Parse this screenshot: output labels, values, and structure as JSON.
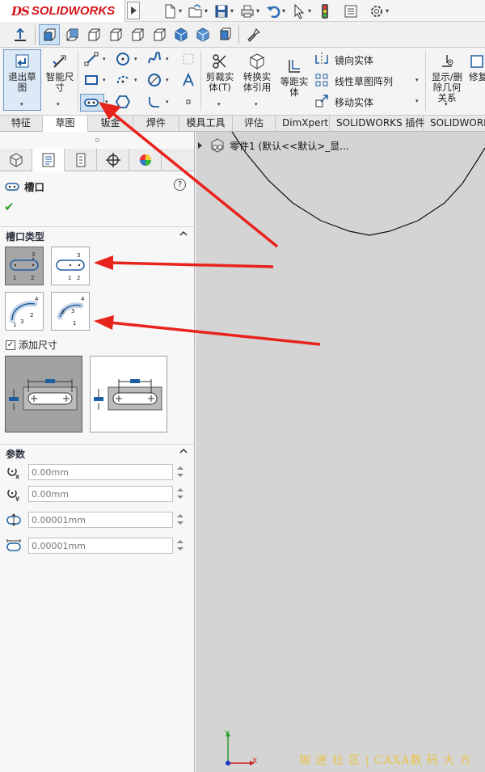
{
  "app": {
    "logo_text": "SOLIDWORKS",
    "logo_mark": "DS"
  },
  "ribbon": {
    "exit_sketch": "退出草\n图",
    "smart_dim": "智能尺\n寸",
    "trim": "剪裁实\n体(T)",
    "convert": "转换实\n体引用",
    "offset": "等距实\n体",
    "mirror": "镜向实体",
    "linear_pattern": "线性草图阵列",
    "move": "移动实体",
    "display_delete": "显示/删\n除几何\n关系",
    "repair": "修复"
  },
  "tabs": [
    "特征",
    "草图",
    "钣金",
    "焊件",
    "模具工具",
    "评估",
    "DimXpert",
    "SOLIDWORKS 插件",
    "SOLIDWORKS"
  ],
  "tree": {
    "item_label": "零件1  (默认<<默认>_显..."
  },
  "property_manager": {
    "title": "槽口",
    "help": "?",
    "section_slot_type": "槽口类型",
    "add_dimensions_label": "添加尺寸",
    "add_dimensions_checked": true,
    "section_parameters": "参数",
    "params": [
      {
        "icon": "center-x-icon",
        "value": "0.00mm"
      },
      {
        "icon": "center-y-icon",
        "value": "0.00mm"
      },
      {
        "icon": "slot-width-icon",
        "value": "0.00001mm"
      },
      {
        "icon": "slot-length-icon",
        "value": "0.00001mm"
      }
    ]
  },
  "watermark": "咖 迷 社 区 | CAXA数 码 大 方",
  "triad": {
    "x": "X",
    "y": "Y"
  },
  "colors": {
    "brand_red": "#d4141a",
    "annotation_arrow": "#e8231c",
    "graphics_bg": "#d4d4d4",
    "selection_blue": "#6e95c6"
  }
}
